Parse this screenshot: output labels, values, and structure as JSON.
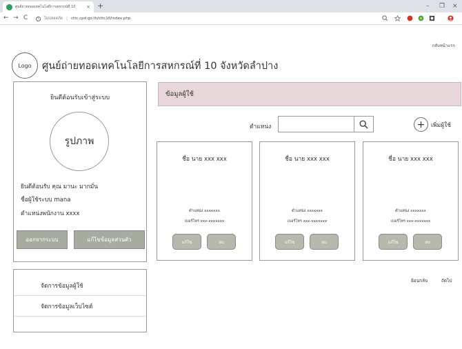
{
  "browser": {
    "tab_title": "ศูนย์ถ่ายทอดเทคโนโลยีการสหกรณ์ที่ 10",
    "tab_close": "×",
    "new_tab": "+",
    "window_minimize": "–",
    "window_restore": "❐",
    "window_close": "×",
    "nav_back": "←",
    "nav_forward": "→",
    "nav_reload": "C",
    "security_label": "ไม่ปลอดภัย",
    "separator": "|",
    "url": "cttc.cpd.go.th/cttc10/index.php",
    "icons": [
      "search-icon",
      "star-icon",
      "extension-icon",
      "extension-icon",
      "extension-icon",
      "profile-icon"
    ]
  },
  "header": {
    "logo_text": "Logo",
    "site_title": "ศูนย์ถ่ายทอดเทคโนโลยีการสหกรณ์ที่ 10 จังหวัดลำปาง",
    "home_link": "กลับหน้าแรก"
  },
  "login": {
    "title": "ยินดีต้อนรับเข้าสู่ระบบ",
    "photo_label": "รูปภาพ",
    "welcome_line": "ยินดีต้อนรับ คุณ มานะ มากมั่น",
    "username_line": "ชื่อผู้ใช้ระบบ mana",
    "position_line": "ตำแหน่งพนักงาน xxxx",
    "logout_button": "ออกจากระบบ",
    "edit_profile_button": "แก้ไขข้อมูลส่วนตัว"
  },
  "menu": {
    "items": [
      {
        "label": "จัดการข้อมูลผู้ใช้"
      },
      {
        "label": "จัดการข้อมูลเว็บไซต์"
      }
    ]
  },
  "main": {
    "section_title": "ข้อมูลผู้ใช้",
    "position_label": "ตำแหน่ง",
    "search_value": "",
    "search_placeholder": "",
    "add_user_label": "เพิ่มผู้ใช้",
    "cards": [
      {
        "name": "ชื่อ นาย xxx  xxx",
        "position": "ตำแหน่ง xxxxxxx",
        "phone": "เบอร์โทร xxx-xxxxxxx",
        "edit_label": "แก้ไข",
        "delete_label": "ลบ"
      },
      {
        "name": "ชื่อ นาย xxx  xxx",
        "position": "ตำแหน่ง xxxxxxx",
        "phone": "เบอร์โทร xxx-xxxxxxx",
        "edit_label": "แก้ไข",
        "delete_label": "ลบ"
      },
      {
        "name": "ชื่อ นาย xxx  xxx",
        "position": "ตำแหน่ง xxxxxxx",
        "phone": "เบอร์โทร xxx-xxxxxxx",
        "edit_label": "แก้ไข",
        "delete_label": "ลบ"
      }
    ],
    "pager_back": "ย้อนกลับ",
    "pager_next": "ถัดไป"
  },
  "colors": {
    "header_bar": "#e7d7db",
    "button_gray": "#a7aba0",
    "card_button": "#b6b9ae",
    "favicon": "#2e9e5b"
  }
}
